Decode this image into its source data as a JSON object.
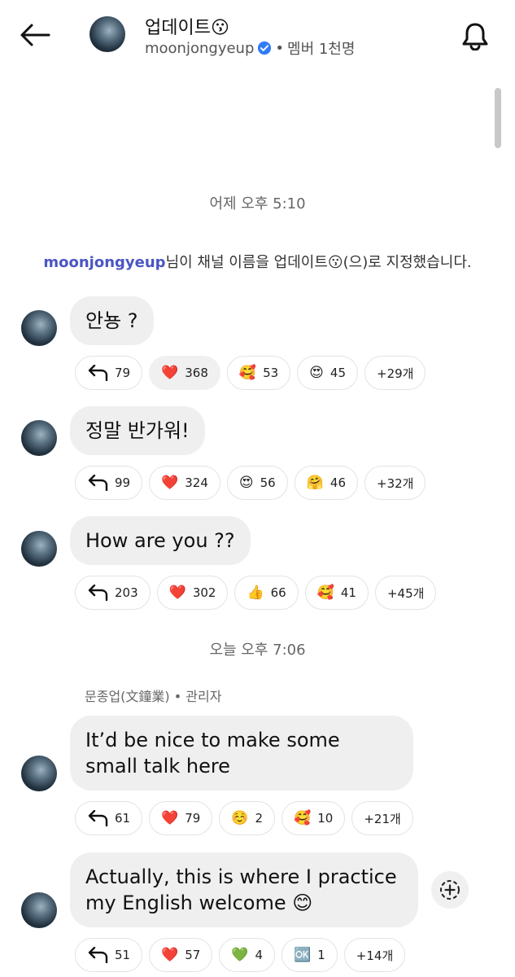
{
  "header": {
    "title": "업데이트😗",
    "username": "moonjongyeup",
    "separator": "•",
    "members": "멤버 1천명"
  },
  "timestamps": [
    "어제 오후 5:10",
    "오늘 오후 7:06"
  ],
  "system_message": {
    "name": "moonjongyeup",
    "text": "님이 채널 이름을 업데이트😗(으)로 지정했습니다."
  },
  "messages": [
    {
      "text": "안뇽 ?",
      "reactions": [
        {
          "emoji": "reply-icon",
          "count": "79"
        },
        {
          "emoji": "❤️",
          "count": "368"
        },
        {
          "emoji": "🥰",
          "count": "53"
        },
        {
          "emoji": "😍",
          "count": "45"
        },
        {
          "emoji": "",
          "count": "+29개"
        }
      ]
    },
    {
      "text": "정말 반가워!",
      "reactions": [
        {
          "emoji": "reply-icon",
          "count": "99"
        },
        {
          "emoji": "❤️",
          "count": "324"
        },
        {
          "emoji": "😍",
          "count": "56"
        },
        {
          "emoji": "🤗",
          "count": "46"
        },
        {
          "emoji": "",
          "count": "+32개"
        }
      ]
    },
    {
      "text": "How are you ??",
      "reactions": [
        {
          "emoji": "reply-icon",
          "count": "203"
        },
        {
          "emoji": "❤️",
          "count": "302"
        },
        {
          "emoji": "👍",
          "count": "66"
        },
        {
          "emoji": "🥰",
          "count": "41"
        },
        {
          "emoji": "",
          "count": "+45개"
        }
      ]
    },
    {
      "sender": "문종업(文鐘業)",
      "sender_role": "• 관리자",
      "text": "It’d be nice to make some small talk here",
      "reactions": [
        {
          "emoji": "reply-icon",
          "count": "61"
        },
        {
          "emoji": "❤️",
          "count": "79"
        },
        {
          "emoji": "☺️",
          "count": "2"
        },
        {
          "emoji": "🥰",
          "count": "10"
        },
        {
          "emoji": "",
          "count": "+21개"
        }
      ]
    },
    {
      "text": "Actually, this is where I practice my English welcome 😊",
      "reactions": [
        {
          "emoji": "reply-icon",
          "count": "51"
        },
        {
          "emoji": "❤️",
          "count": "57"
        },
        {
          "emoji": "💚",
          "count": "4"
        },
        {
          "emoji": "🆗",
          "count": "1"
        },
        {
          "emoji": "",
          "count": "+14개"
        }
      ]
    }
  ],
  "colors": {
    "accent_name": "#4b55c4",
    "bubble": "#efefef",
    "verified": "#2f7cf6"
  }
}
